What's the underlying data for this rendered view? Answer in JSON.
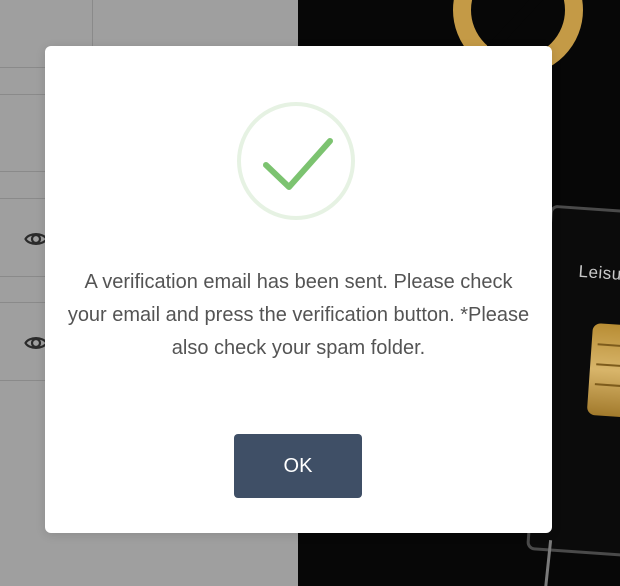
{
  "background": {
    "card_label": "Leisu"
  },
  "dialog": {
    "icon": "checkmark-circle-icon",
    "message": "A verification email has been sent. Please check your email and press the verification button. *Please also check your spam folder.",
    "ok_label": "OK"
  },
  "colors": {
    "overlay_left": "#9f9f9f",
    "overlay_right": "#070707",
    "checkmark": "#7cc370",
    "ring": "#e6f2e3",
    "button": "#3f4f66",
    "text": "#545454",
    "gold": "#c49a46"
  }
}
